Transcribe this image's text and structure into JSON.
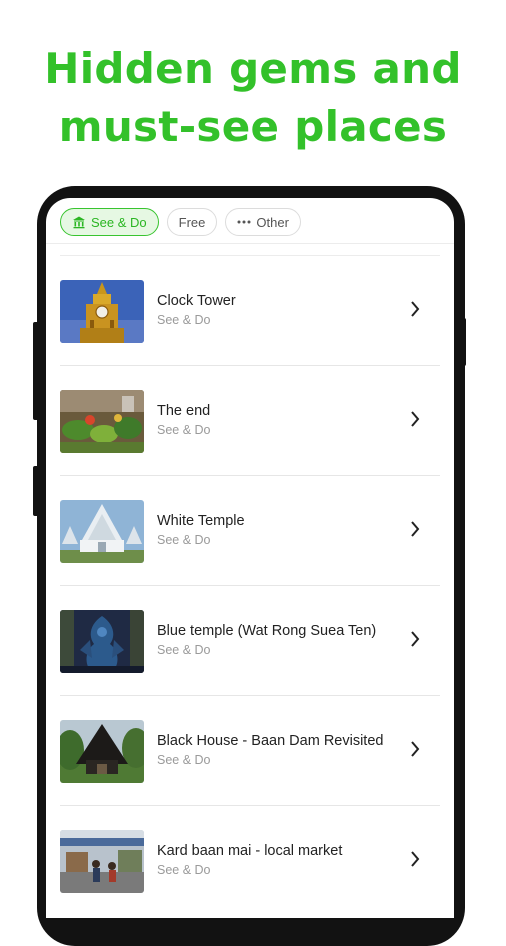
{
  "headline": {
    "line1": "Hidden gems and",
    "line2": "must-see places"
  },
  "filters": [
    {
      "label": "See & Do",
      "icon": "museum-icon",
      "active": true
    },
    {
      "label": "Free",
      "active": false
    },
    {
      "label": "Other",
      "icon": "more-horizontal-icon",
      "active": false
    }
  ],
  "places": [
    {
      "title": "Clock Tower",
      "category": "See & Do"
    },
    {
      "title": "The end",
      "category": "See & Do"
    },
    {
      "title": "White Temple",
      "category": "See & Do"
    },
    {
      "title": "Blue temple (Wat Rong Suea Ten)",
      "category": "See & Do"
    },
    {
      "title": "Black House - Baan Dam Revisited",
      "category": "See & Do"
    },
    {
      "title": "Kard baan mai - local market",
      "category": "See & Do"
    }
  ],
  "colors": {
    "accent": "#33c12a",
    "chip_active_bg": "#e6f8e3",
    "phone_frame": "#121212"
  }
}
